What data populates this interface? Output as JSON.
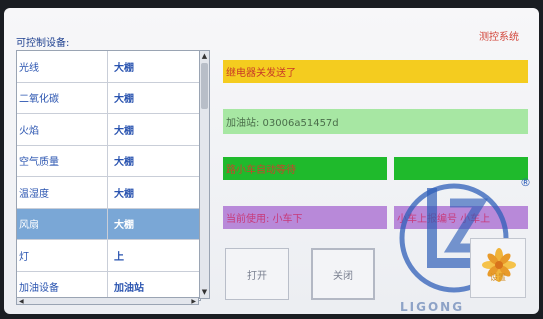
{
  "header": {
    "system_title": "测控系统"
  },
  "device_list": {
    "title": "可控制设备:",
    "selected_index": 5,
    "rows": [
      {
        "name": "光线",
        "location": "大棚"
      },
      {
        "name": "二氧化碳",
        "location": "大棚"
      },
      {
        "name": "火焰",
        "location": "大棚"
      },
      {
        "name": "空气质量",
        "location": "大棚"
      },
      {
        "name": "温湿度",
        "location": "大棚"
      },
      {
        "name": "风扇",
        "location": "大棚"
      },
      {
        "name": "灯",
        "location": "上"
      },
      {
        "name": "加油设备",
        "location": "加油站"
      }
    ]
  },
  "status": {
    "relay_message": "继电器关发送了",
    "station_message": "加油站: 03006a51457d",
    "car_message": "路小车自动等待",
    "using_message": "当前使用: 小车下",
    "taking_message": "小车上报编号 小车上"
  },
  "controls": {
    "open_label": "打开",
    "close_label": "关闭",
    "settings_label": "设置"
  },
  "logo": {
    "text": "LIGONG",
    "trademark": "®"
  },
  "colors": {
    "yellow_bar": "#f4cc1f",
    "light_green_bar": "#a7e7a3",
    "green_bar": "#1fba2c",
    "purple_bar": "#b889d9",
    "selection": "#7aa7d6",
    "logo_blue": "#2f5fb8"
  },
  "icons": {
    "scroll_up": "triangle-up-icon",
    "scroll_down": "triangle-down-icon",
    "scroll_left": "triangle-left-icon",
    "scroll_right": "triangle-right-icon",
    "settings": "flower-settings-icon"
  }
}
